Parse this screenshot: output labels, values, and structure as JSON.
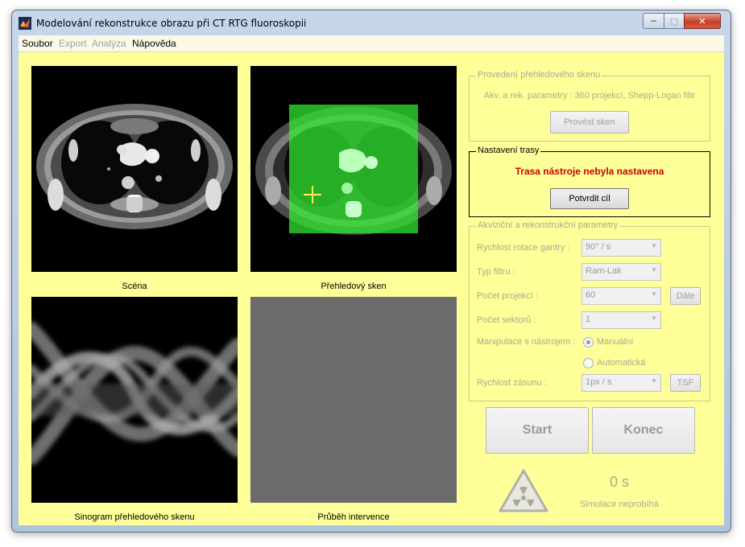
{
  "window": {
    "title": "Modelování rekonstrukce obrazu při CT RTG fluoroskopii"
  },
  "menu": [
    "Soubor",
    "Export",
    "Analýza",
    "Nápověda"
  ],
  "panels": {
    "scene_caption": "Scéna",
    "overview_caption": "Přehledový sken",
    "sinogram_caption": "Sinogram přehledového skenu",
    "intervention_caption": "Průběh intervence"
  },
  "overview_scan": {
    "title": "Provedení přehledového skenu",
    "params": "Akv. a rek. parametry : 360 projekcí, Shepp-Logan filtr",
    "button": "Provést sken"
  },
  "trajectory": {
    "title": "Nastavení trasy",
    "status": "Trasa nástroje nebyla nastavena",
    "button": "Potvrdit cíl"
  },
  "acq": {
    "title": "Akviziční a rekonstrukční parametry",
    "gantry_label": "Rychlost rotace gantry :",
    "gantry_value": "90° / s",
    "filter_label": "Typ filtru :",
    "filter_value": "Ram-Lak",
    "projections_label": "Počet projekcí :",
    "projections_value": "60",
    "next_button": "Dále",
    "sectors_label": "Počet sektorů :",
    "sectors_value": "1",
    "manipulation_label": "Manipulace s nástrojem :",
    "manual_label": "Manuální",
    "auto_label": "Automatická",
    "speed_label": "Rychlost zásunu :",
    "speed_value": "1px / s",
    "tsf_button": "TSF"
  },
  "controls": {
    "start": "Start",
    "end": "Konec",
    "time": "0 s",
    "status": "Simulace neprobíhá"
  },
  "icons": {
    "app": "matlab-icon",
    "radiation": "radiation-icon",
    "crosshair": "crosshair-icon"
  },
  "colors": {
    "background": "#ffff99",
    "alert": "#cc0000",
    "overlay": "#33ee33",
    "crosshair": "#ffee55"
  }
}
